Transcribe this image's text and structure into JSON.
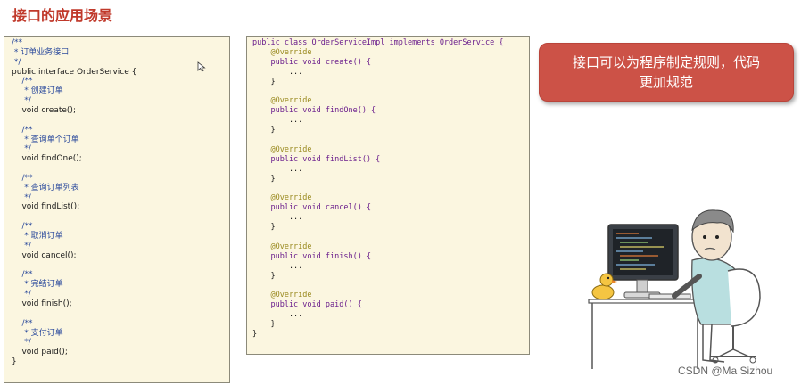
{
  "page_title": "接口的应用场景",
  "left_code": [
    {
      "t": "/**",
      "c": "comment"
    },
    {
      "t": " * 订单业务接口",
      "c": "comment"
    },
    {
      "t": " */",
      "c": "comment"
    },
    {
      "t": "public interface OrderService {",
      "c": "type"
    },
    {
      "t": "    /**",
      "c": "comment"
    },
    {
      "t": "     * 创建订单",
      "c": "comment"
    },
    {
      "t": "     */",
      "c": "comment"
    },
    {
      "t": "    void create();",
      "c": "plain"
    },
    {
      "t": "",
      "c": "plain"
    },
    {
      "t": "    /**",
      "c": "comment"
    },
    {
      "t": "     * 查询单个订单",
      "c": "comment"
    },
    {
      "t": "     */",
      "c": "comment"
    },
    {
      "t": "    void findOne();",
      "c": "plain"
    },
    {
      "t": "",
      "c": "plain"
    },
    {
      "t": "    /**",
      "c": "comment"
    },
    {
      "t": "     * 查询订单列表",
      "c": "comment"
    },
    {
      "t": "     */",
      "c": "comment"
    },
    {
      "t": "    void findList();",
      "c": "plain"
    },
    {
      "t": "",
      "c": "plain"
    },
    {
      "t": "    /**",
      "c": "comment"
    },
    {
      "t": "     * 取消订单",
      "c": "comment"
    },
    {
      "t": "     */",
      "c": "comment"
    },
    {
      "t": "    void cancel();",
      "c": "plain"
    },
    {
      "t": "",
      "c": "plain"
    },
    {
      "t": "    /**",
      "c": "comment"
    },
    {
      "t": "     * 完结订单",
      "c": "comment"
    },
    {
      "t": "     */",
      "c": "comment"
    },
    {
      "t": "    void finish();",
      "c": "plain"
    },
    {
      "t": "",
      "c": "plain"
    },
    {
      "t": "    /**",
      "c": "comment"
    },
    {
      "t": "     * 支付订单",
      "c": "comment"
    },
    {
      "t": "     */",
      "c": "comment"
    },
    {
      "t": "    void paid();",
      "c": "plain"
    },
    {
      "t": "}",
      "c": "plain"
    }
  ],
  "right_code": [
    {
      "t": "public class OrderServiceImpl implements OrderService {",
      "c": "keyword"
    },
    {
      "t": "    @Override",
      "c": "annotation"
    },
    {
      "t": "    public void create() {",
      "c": "keyword"
    },
    {
      "t": "        ...",
      "c": "plain"
    },
    {
      "t": "    }",
      "c": "plain"
    },
    {
      "t": "",
      "c": "plain"
    },
    {
      "t": "    @Override",
      "c": "annotation"
    },
    {
      "t": "    public void findOne() {",
      "c": "keyword"
    },
    {
      "t": "        ...",
      "c": "plain"
    },
    {
      "t": "    }",
      "c": "plain"
    },
    {
      "t": "",
      "c": "plain"
    },
    {
      "t": "    @Override",
      "c": "annotation"
    },
    {
      "t": "    public void findList() {",
      "c": "keyword"
    },
    {
      "t": "        ...",
      "c": "plain"
    },
    {
      "t": "    }",
      "c": "plain"
    },
    {
      "t": "",
      "c": "plain"
    },
    {
      "t": "    @Override",
      "c": "annotation"
    },
    {
      "t": "    public void cancel() {",
      "c": "keyword"
    },
    {
      "t": "        ...",
      "c": "plain"
    },
    {
      "t": "    }",
      "c": "plain"
    },
    {
      "t": "",
      "c": "plain"
    },
    {
      "t": "    @Override",
      "c": "annotation"
    },
    {
      "t": "    public void finish() {",
      "c": "keyword"
    },
    {
      "t": "        ...",
      "c": "plain"
    },
    {
      "t": "    }",
      "c": "plain"
    },
    {
      "t": "",
      "c": "plain"
    },
    {
      "t": "    @Override",
      "c": "annotation"
    },
    {
      "t": "    public void paid() {",
      "c": "keyword"
    },
    {
      "t": "        ...",
      "c": "plain"
    },
    {
      "t": "    }",
      "c": "plain"
    },
    {
      "t": "}",
      "c": "plain"
    }
  ],
  "callout": {
    "line1": "接口可以为程序制定规则，代码",
    "line2": "更加规范"
  },
  "watermark": "CSDN @Ma Sizhou",
  "colors": {
    "title": "#c0392b",
    "panel_bg": "#fbf6e0",
    "callout_bg": "#cc5247",
    "comment": "#2b4a9c",
    "keyword": "#6a1d8c",
    "annotation": "#9a8a1f"
  }
}
